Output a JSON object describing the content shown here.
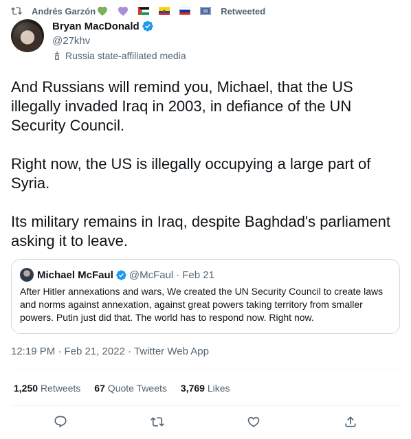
{
  "retweet_context": {
    "user": "Andrés Garzón",
    "suffix": "Retweeted",
    "emojis": [
      "green-heart",
      "purple-heart",
      "palestine-flag",
      "ecuador-flag",
      "russia-flag",
      "flag"
    ]
  },
  "author": {
    "name": "Bryan MacDonald",
    "handle": "@27khv",
    "verified": true,
    "label": "Russia state-affiliated media"
  },
  "tweet": {
    "paragraphs": [
      "And Russians will remind you, Michael, that the US illegally invaded Iraq in 2003, in defiance of the UN Security Council.",
      "Right now, the US is illegally occupying a large part of Syria.",
      "Its military remains in Iraq, despite Baghdad's parliament asking it to leave."
    ],
    "timestamp": "12:19 PM · Feb 21, 2022 · Twitter Web App"
  },
  "quoted_tweet": {
    "name": "Michael McFaul",
    "handle": "@McFaul",
    "separator": "·",
    "date": "Feb 21",
    "text": "After Hitler annexations and wars, We created the UN Security Council to create laws and norms against annexation, against great powers taking territory from smaller powers. Putin just did that. The world has to respond now. Right now."
  },
  "stats": {
    "retweets_count": "1,250",
    "retweets_label": "Retweets",
    "quotes_count": "67",
    "quotes_label": "Quote Tweets",
    "likes_count": "3,769",
    "likes_label": "Likes"
  },
  "actions": [
    "reply-icon",
    "retweet-icon",
    "like-icon",
    "share-icon"
  ],
  "colors": {
    "text": "#0f1419",
    "secondary": "#536471",
    "verified": "#1d9bf0",
    "border": "#cfd9de",
    "divider": "#eff3f4"
  }
}
